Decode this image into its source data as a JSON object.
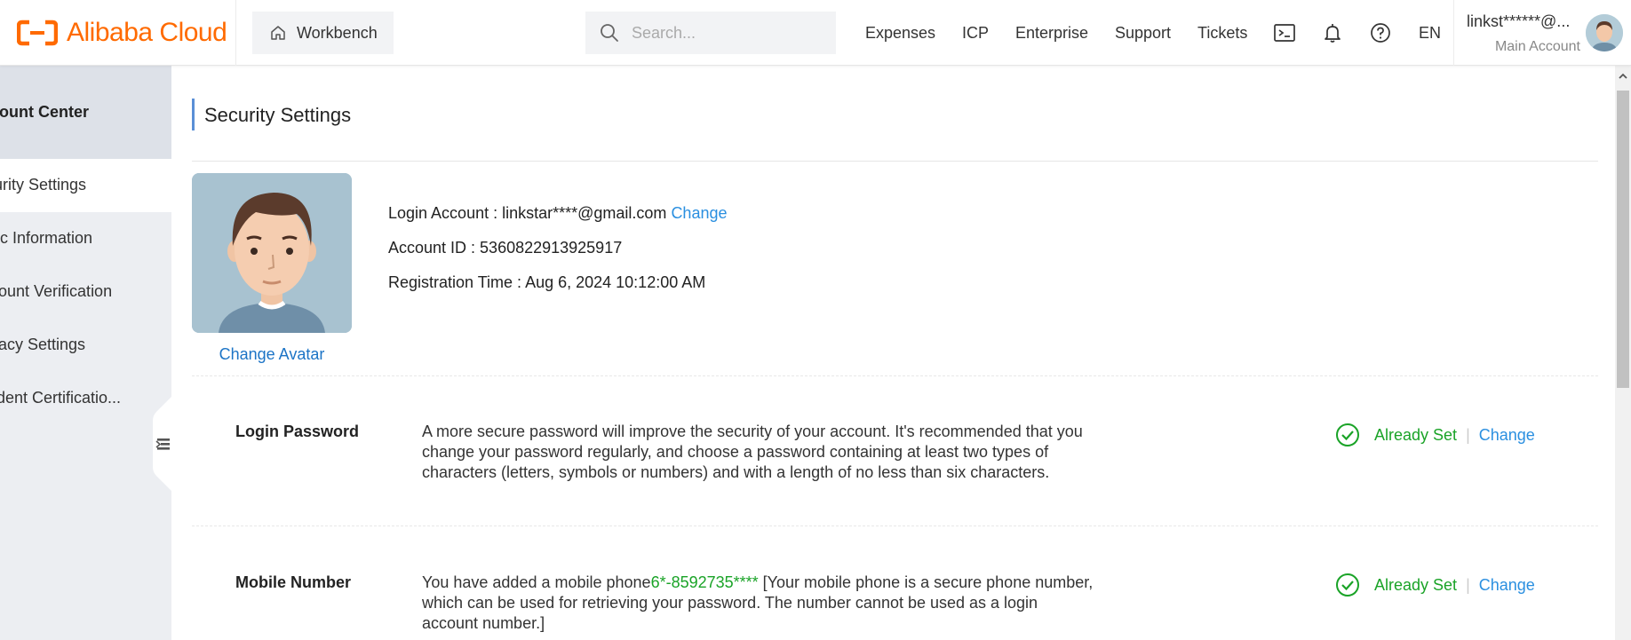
{
  "brand": {
    "logo_text": "Alibaba Cloud",
    "accent": "#ff6a00"
  },
  "topbar": {
    "workbench_label": "Workbench",
    "search_placeholder": "Search...",
    "links": {
      "expenses": "Expenses",
      "icp": "ICP",
      "enterprise": "Enterprise",
      "support": "Support",
      "tickets": "Tickets",
      "language": "EN"
    },
    "icons": [
      "terminal-icon",
      "bell-icon",
      "help-icon"
    ],
    "user": {
      "name": "linkst******@...",
      "role": "Main Account"
    }
  },
  "sidebar": {
    "title": "Account Center",
    "title_visible": "unt Center",
    "items": [
      {
        "label": "urity Settings",
        "active": true
      },
      {
        "label": "ic Information",
        "active": false
      },
      {
        "label": "ount Verification",
        "active": false
      },
      {
        "label": "acy Settings",
        "active": false
      },
      {
        "label": "dent Certificatio...",
        "active": false
      }
    ]
  },
  "main": {
    "page_title": "Security Settings",
    "change_avatar": "Change Avatar",
    "account": {
      "login_label": "Login Account : ",
      "login_value": "linkstar****@gmail.com",
      "login_change": "Change",
      "id_label": "Account ID : ",
      "id_value": "5360822913925917",
      "reg_label": "Registration Time : ",
      "reg_value": "Aug 6, 2024 10:12:00 AM"
    },
    "security_items": [
      {
        "label": "Login Password",
        "description": "A more secure password will improve the security of your account. It's recommended that you change your password regularly, and choose a password containing at least two types of characters (letters, symbols or numbers) and with a length of no less than six characters.",
        "status": "Already Set",
        "action": "Change"
      },
      {
        "label": "Mobile Number",
        "description_prefix": "You have added a mobile phone",
        "description_highlight": "6*-8592735****",
        "description_suffix": " [Your mobile phone is a secure phone number, which can be used for retrieving your password. The number cannot be used as a login account number.]",
        "status": "Already Set",
        "action": "Change"
      }
    ],
    "status_color": "#1aa327",
    "link_color": "#2a8fe0"
  }
}
